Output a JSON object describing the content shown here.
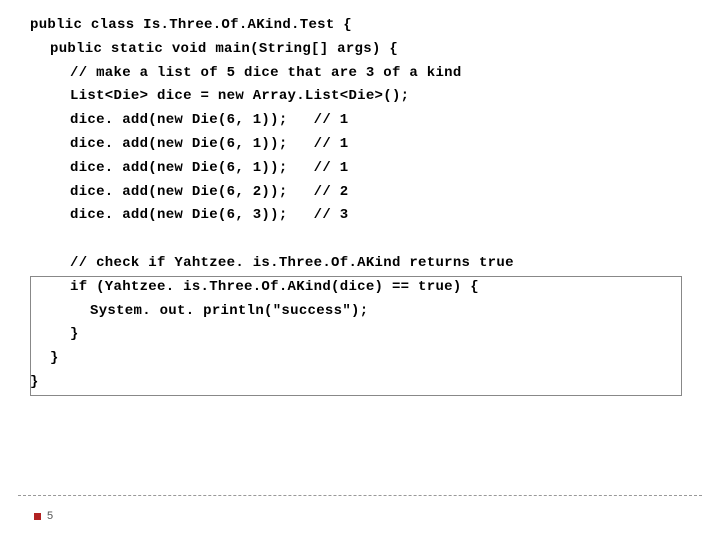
{
  "code": {
    "l1": "public class Is.Three.Of.AKind.Test {",
    "l2": "public static void main(String[] args) {",
    "l3": "// make a list of 5 dice that are 3 of a kind",
    "l4": "List<Die> dice = new Array.List<Die>();",
    "l5": "dice. add(new Die(6, 1));   // 1",
    "l6": "dice. add(new Die(6, 1));   // 1",
    "l7": "dice. add(new Die(6, 1));   // 1",
    "l8": "dice. add(new Die(6, 2));   // 2",
    "l9": "dice. add(new Die(6, 3));   // 3",
    "l10": "// check if Yahtzee. is.Three.Of.AKind returns true",
    "l11": "if (Yahtzee. is.Three.Of.AKind(dice) == true) {",
    "l12": "System. out. println(\"success\");",
    "l13": "}",
    "l14": "}",
    "l15": "}"
  },
  "slide_number": "5"
}
